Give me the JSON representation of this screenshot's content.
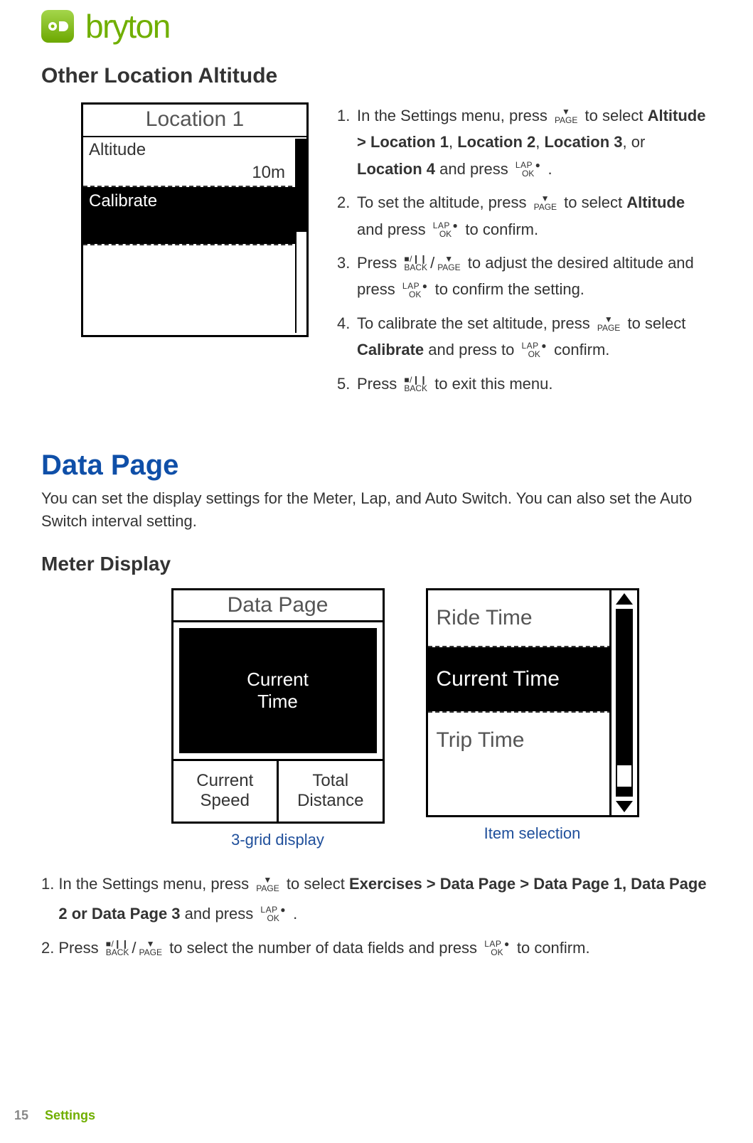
{
  "brand": {
    "name": "bryton"
  },
  "header": {
    "title": "Other Location Altitude"
  },
  "location1": {
    "title": "Location 1",
    "altitude_label": "Altitude",
    "altitude_value": "10m",
    "calibrate_label": "Calibrate"
  },
  "buttons": {
    "page_top": "▼",
    "page_bot": "PAGE",
    "ok_top": "LAP ●",
    "ok_bot": "OK",
    "back_top": "■/❙❙",
    "back_bot": "BACK"
  },
  "steps": {
    "s1_a": "In the Settings menu, press ",
    "s1_b": " to select ",
    "s1_bold1": "Altitude > Location 1",
    "s1_c": ", ",
    "s1_bold2": "Location 2",
    "s1_d": ", ",
    "s1_bold3": "Location 3",
    "s1_e": ", or ",
    "s1_bold4": "Location 4",
    "s1_f": " and press ",
    "s1_g": " .",
    "s2_a": "To set the altitude, press ",
    "s2_b": " to select ",
    "s2_bold": "Altitude",
    "s2_c": " and press ",
    "s2_d": " to confirm.",
    "s3_a": "Press ",
    "s3_b": " to adjust the desired altitude and press ",
    "s3_c": " to confirm the setting.",
    "s4_a": "To calibrate the set altitude, press ",
    "s4_b": " to select ",
    "s4_bold": "Calibrate",
    "s4_c": " and press to ",
    "s4_d": " confirm.",
    "s5_a": "Press ",
    "s5_b": " to exit this menu."
  },
  "data_page": {
    "title": "Data Page",
    "intro": "You can set the display settings for the Meter, Lap, and Auto Switch. You can also set the Auto Switch interval setting.",
    "meter_title": "Meter Display"
  },
  "meterA": {
    "title": "Data Page",
    "big": "Current\nTime",
    "cell1": "Current\nSpeed",
    "cell2": "Total\nDistance",
    "caption": "3-grid display"
  },
  "meterB": {
    "item1": "Ride Time",
    "item2": "Current Time",
    "item3": "Trip Time",
    "caption": "Item selection"
  },
  "steps2": {
    "s1_a": "In the Settings menu, press ",
    "s1_b": " to select ",
    "s1_bold1": "Exercises > Data Page >  Data Page 1, Data Page 2 or Data Page 3",
    "s1_c": " and press ",
    "s1_d": " .",
    "s2_a": "Press ",
    "s2_b": " to select the number of data fields and press ",
    "s2_c": " to confirm."
  },
  "footer": {
    "page": "15",
    "label": "Settings"
  }
}
